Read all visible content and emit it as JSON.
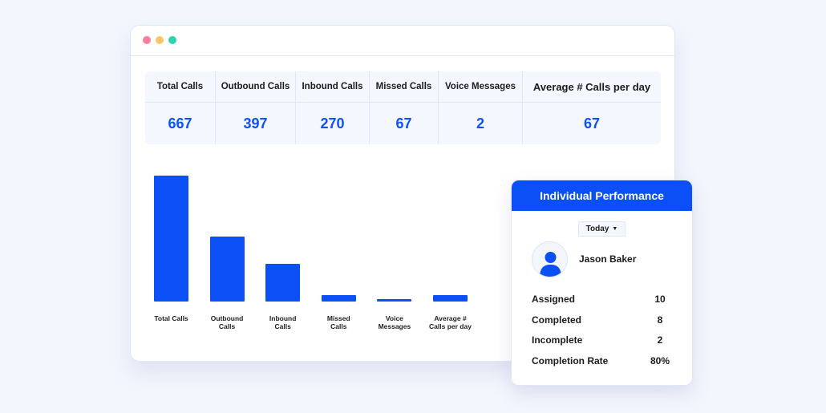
{
  "window": {
    "controls": [
      "close",
      "minimize",
      "maximize"
    ]
  },
  "stats": [
    {
      "label": "Total Calls",
      "value": "667"
    },
    {
      "label": "Outbound Calls",
      "value": "397"
    },
    {
      "label": "Inbound Calls",
      "value": "270"
    },
    {
      "label": "Missed Calls",
      "value": "67"
    },
    {
      "label": "Voice Messages",
      "value": "2"
    },
    {
      "label": "Average # Calls per day",
      "value": "67"
    }
  ],
  "chart_data": {
    "type": "bar",
    "title": "",
    "xlabel": "",
    "ylabel": "",
    "categories": [
      "Total Calls",
      "Outbound Calls",
      "Inbound Calls",
      "Missed Calls",
      "Voice Messages",
      "Average # Calls per day"
    ],
    "category_lines": [
      [
        "Total Calls"
      ],
      [
        "Outbound",
        "Calls"
      ],
      [
        "Inbound",
        "Calls"
      ],
      [
        "Missed",
        "Calls"
      ],
      [
        "Voice",
        "Messages"
      ],
      [
        "Average #",
        "Calls per day"
      ]
    ],
    "values": [
      667,
      345,
      200,
      35,
      10,
      35
    ],
    "ylim": [
      0,
      667
    ],
    "grid": false,
    "color": "#0b4ff7"
  },
  "performance": {
    "title": "Individual Performance",
    "period": "Today",
    "person": "Jason Baker",
    "metrics": [
      {
        "label": "Assigned",
        "value": "10"
      },
      {
        "label": "Completed",
        "value": "8"
      },
      {
        "label": "Incomplete",
        "value": "2"
      },
      {
        "label": "Completion Rate",
        "value": "80%"
      }
    ]
  },
  "colors": {
    "accent": "#0b4ff7",
    "value_text": "#0d52f5",
    "background": "#f3f6fd"
  }
}
